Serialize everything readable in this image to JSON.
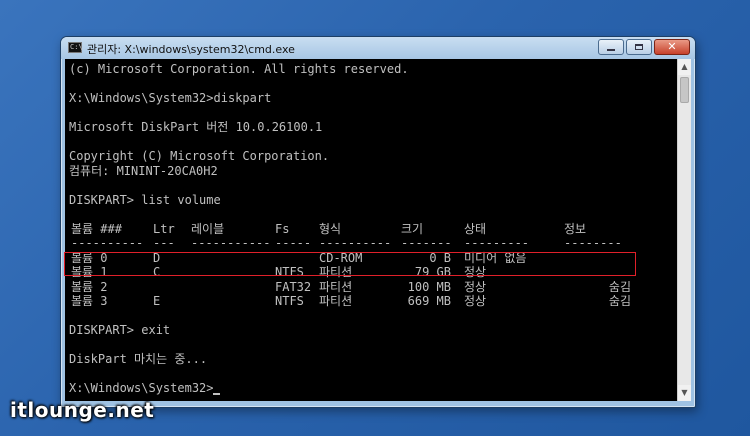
{
  "window": {
    "title": "관리자: X:\\windows\\system32\\cmd.exe",
    "app_icon": "cmd-icon",
    "controls": {
      "minimize": "minimize-icon",
      "maximize": "maximize-icon",
      "close": "close-icon"
    }
  },
  "console": {
    "lines": [
      "(c) Microsoft Corporation. All rights reserved.",
      "",
      "X:\\Windows\\System32>diskpart",
      "",
      "Microsoft DiskPart 버전 10.0.26100.1",
      "",
      "Copyright (C) Microsoft Corporation.",
      "컴퓨터: MININT-20CA0H2",
      "",
      "DISKPART> list volume",
      "",
      "",
      "",
      "",
      "",
      "",
      "",
      "",
      "DISKPART> exit",
      "",
      "DiskPart 마치는 중...",
      "",
      "X:\\Windows\\System32>"
    ],
    "table": {
      "headers": [
        "볼륨 ###",
        "Ltr",
        "레이블",
        "Fs",
        "형식",
        "크기",
        "상태",
        "정보"
      ],
      "separators": [
        "----------",
        "---",
        "-----------",
        "-----",
        "----------",
        "-------",
        "---------",
        "--------"
      ],
      "rows": [
        [
          "볼륨 0",
          "D",
          "",
          "",
          "CD-ROM",
          "0 B",
          "미디어 없음",
          ""
        ],
        [
          "볼륨 1",
          "C",
          "",
          "NTFS",
          "파티션",
          "79 GB",
          "정상",
          ""
        ],
        [
          "볼륨 2",
          "",
          "",
          "FAT32",
          "파티션",
          "100 MB",
          "정상",
          "숨김"
        ],
        [
          "볼륨 3",
          "E",
          "",
          "NTFS",
          "파티션",
          "669 MB",
          "정상",
          "숨김"
        ]
      ],
      "highlighted_row": 1
    },
    "colors": {
      "background": "#000000",
      "text": "#c0c0c0",
      "highlight_border": "#e0202a"
    }
  },
  "watermark": "itlounge.net"
}
